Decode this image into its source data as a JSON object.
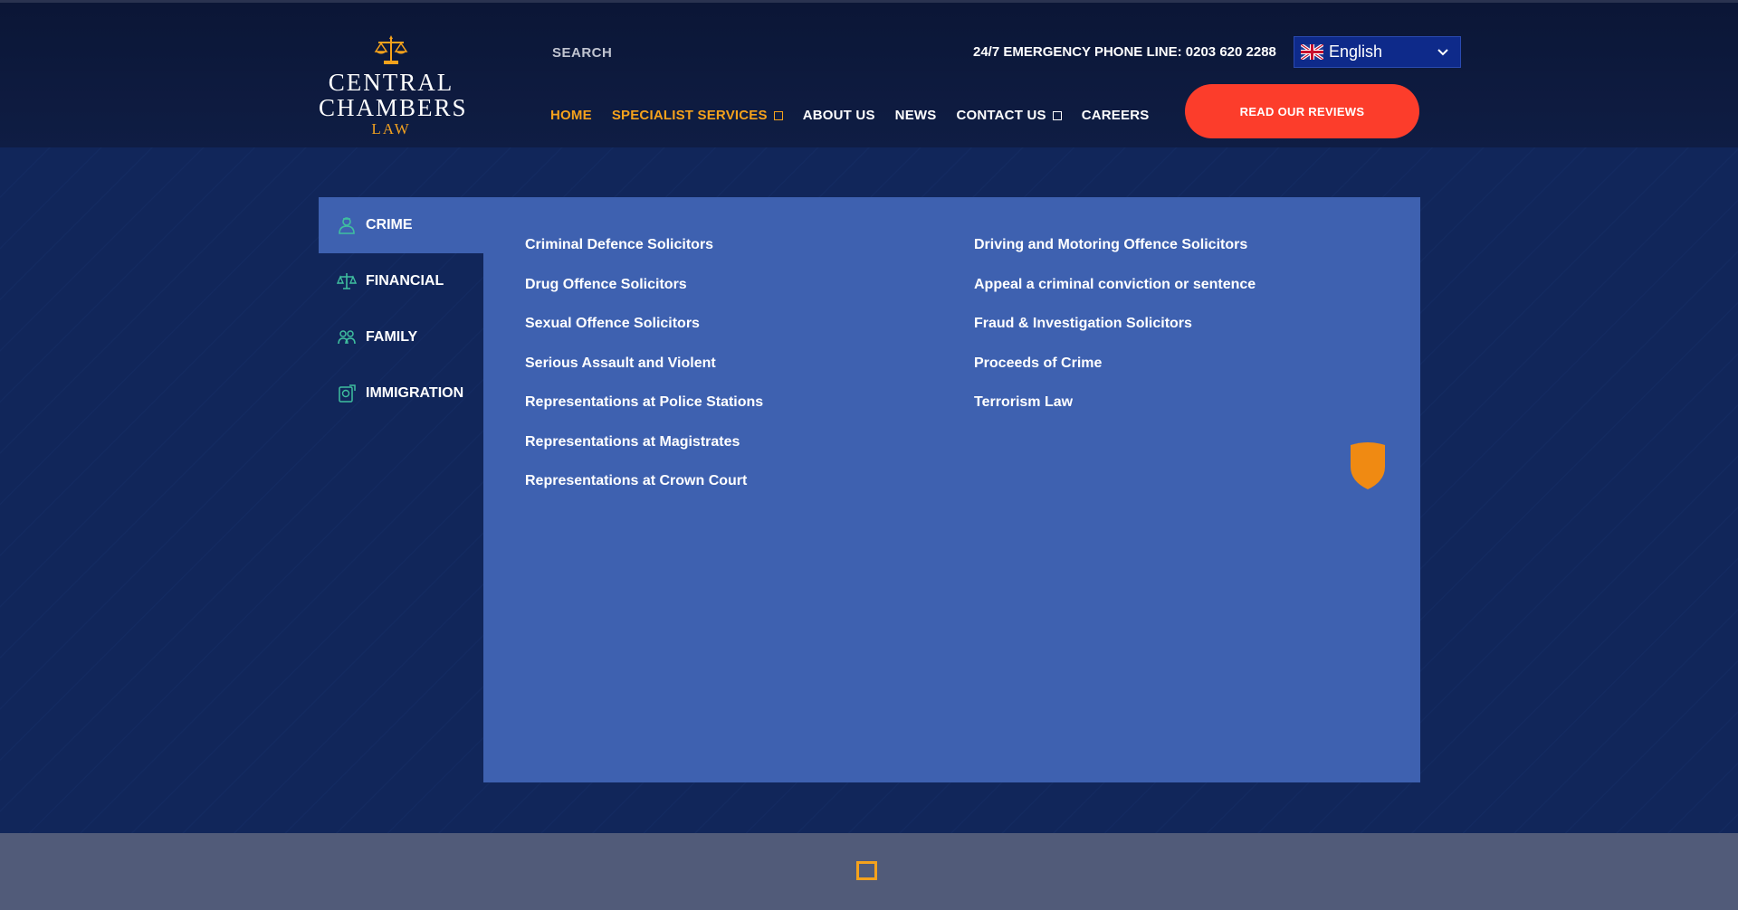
{
  "logo": {
    "line1": "CENTRAL",
    "line2": "CHAMBERS",
    "line3": "LAW"
  },
  "search": {
    "placeholder": "SEARCH"
  },
  "emergency": "24/7 EMERGENCY PHONE LINE: 0203 620 2288",
  "language": {
    "selected": "English"
  },
  "nav": {
    "home": "HOME",
    "specialist": "SPECIALIST SERVICES",
    "about": "ABOUT US",
    "news": "NEWS",
    "contact": "CONTACT US",
    "careers": "CAREERS"
  },
  "reviews_button": "READ OUR REVIEWS",
  "categories": [
    "CRIME",
    "FINANCIAL",
    "FAMILY",
    "IMMIGRATION"
  ],
  "links_left": [
    "Criminal Defence Solicitors",
    "Drug Offence Solicitors",
    "Sexual Offence Solicitors",
    "Serious Assault and Violent",
    "Representations at Police Stations",
    "Representations at Magistrates",
    "Representations at Crown Court"
  ],
  "links_right": [
    "Driving and Motoring Offence Solicitors",
    "Appeal a criminal conviction or sentence",
    "Fraud & Investigation Solicitors",
    "Proceeds of Crime",
    "Terrorism Law"
  ],
  "colors": {
    "accent_orange": "#f5a21c",
    "button_red": "#fc3d2b",
    "panel_blue": "#3e61b0",
    "bg_navy": "#11265a"
  }
}
